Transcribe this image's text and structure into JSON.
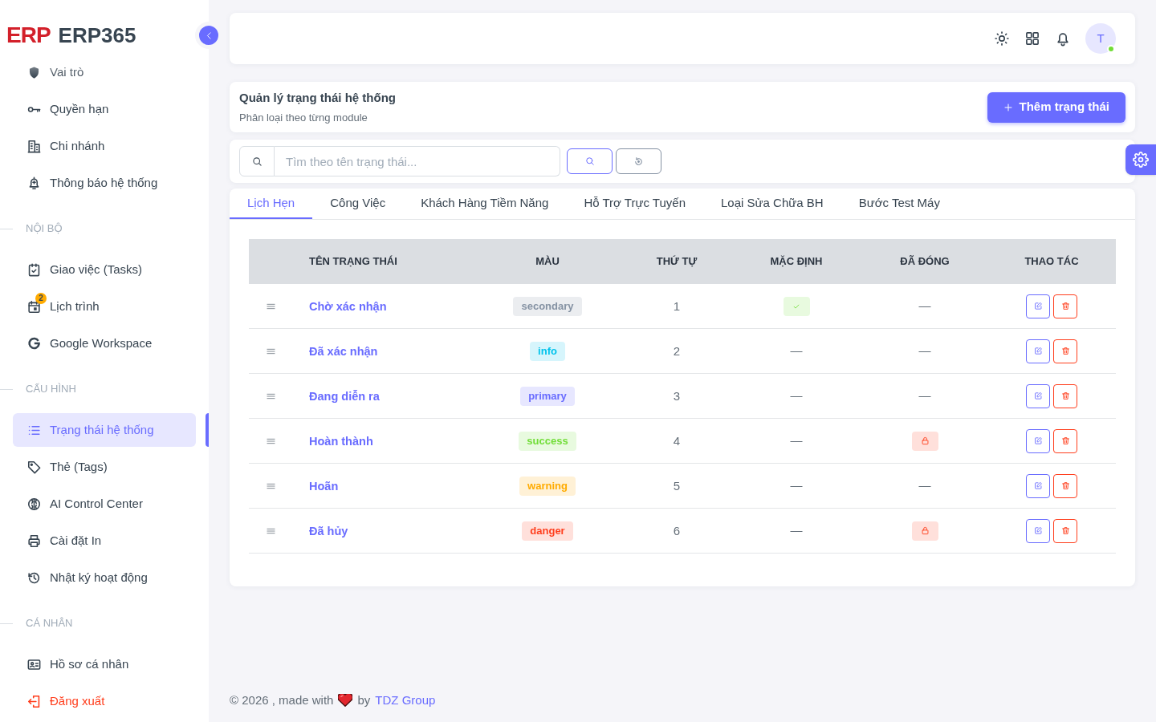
{
  "logo": {
    "mark": "ERP",
    "name": "ERP365"
  },
  "sidebar": {
    "sections": [
      {
        "items": [
          {
            "label": "Vai trò",
            "kind": "link",
            "selected": false
          },
          {
            "label": "Quyền hạn",
            "kind": "link",
            "selected": false
          },
          {
            "label": "Chi nhánh",
            "kind": "link",
            "selected": false
          },
          {
            "label": "Thông báo hệ thống",
            "kind": "link",
            "selected": false
          }
        ]
      },
      {
        "title": "NỘI BỘ",
        "items": [
          {
            "label": "Giao việc (Tasks)",
            "kind": "link",
            "selected": false
          },
          {
            "label": "Lịch trình",
            "kind": "link",
            "selected": false,
            "badge": "2"
          },
          {
            "label": "Google Workspace",
            "kind": "link",
            "selected": false
          }
        ]
      },
      {
        "title": "CẤU HÌNH",
        "items": [
          {
            "label": "Trạng thái hệ thống",
            "kind": "link",
            "selected": true
          },
          {
            "label": "Thẻ (Tags)",
            "kind": "link",
            "selected": false
          },
          {
            "label": "AI Control Center",
            "kind": "link",
            "selected": false
          },
          {
            "label": "Cài đặt In",
            "kind": "link",
            "selected": false
          },
          {
            "label": "Nhật ký hoạt động",
            "kind": "link",
            "selected": false
          }
        ]
      },
      {
        "title": "CÁ NHÂN",
        "items": [
          {
            "label": "Hồ sơ cá nhân",
            "kind": "link",
            "selected": false
          },
          {
            "label": "Đăng xuất",
            "kind": "logout",
            "selected": false
          }
        ]
      }
    ]
  },
  "navbar": {
    "avatar": {
      "initial": "T",
      "online": true
    }
  },
  "page_header": {
    "title": "Quản lý trạng thái hệ thống",
    "subtitle": "Phân loại theo từng module",
    "add_button": "Thêm trạng thái"
  },
  "search": {
    "placeholder": "Tìm theo tên trạng thái..."
  },
  "tabs": [
    {
      "label": "Lịch Hẹn",
      "selected": true
    },
    {
      "label": "Công Việc",
      "selected": false
    },
    {
      "label": "Khách Hàng Tiềm Năng",
      "selected": false
    },
    {
      "label": "Hỗ Trợ Trực Tuyến",
      "selected": false
    },
    {
      "label": "Loại Sửa Chữa BH",
      "selected": false
    },
    {
      "label": "Bước Test Máy",
      "selected": false
    }
  ],
  "table": {
    "columns": [
      "TÊN TRẠNG THÁI",
      "MÀU",
      "THỨ TỰ",
      "MẶC ĐỊNH",
      "ĐÃ ĐÓNG",
      "THAO TÁC"
    ],
    "rows": [
      {
        "name": "Chờ xác nhận",
        "color_label": "secondary",
        "color": "#8592a3",
        "order": "1",
        "default": true,
        "closed": false,
        "closed_text": "—"
      },
      {
        "name": "Đã xác nhận",
        "color_label": "info",
        "color": "#03c3ec",
        "order": "2",
        "default": false,
        "default_text": "—",
        "closed": false,
        "closed_text": "—"
      },
      {
        "name": "Đang diễn ra",
        "color_label": "primary",
        "color": "#696cff",
        "order": "3",
        "default": false,
        "default_text": "—",
        "closed": false,
        "closed_text": "—"
      },
      {
        "name": "Hoàn thành",
        "color_label": "success",
        "color": "#71dd37",
        "order": "4",
        "default": false,
        "default_text": "—",
        "closed": true
      },
      {
        "name": "Hoãn",
        "color_label": "warning",
        "color": "#ffab00",
        "order": "5",
        "default": false,
        "default_text": "—",
        "closed": false,
        "closed_text": "—"
      },
      {
        "name": "Đã hủy",
        "color_label": "danger",
        "color": "#ff3e1d",
        "order": "6",
        "default": false,
        "default_text": "—",
        "closed": true
      }
    ]
  },
  "footer": {
    "credit": "© 2026 , made with",
    "by": "by",
    "link": "TDZ Group"
  }
}
